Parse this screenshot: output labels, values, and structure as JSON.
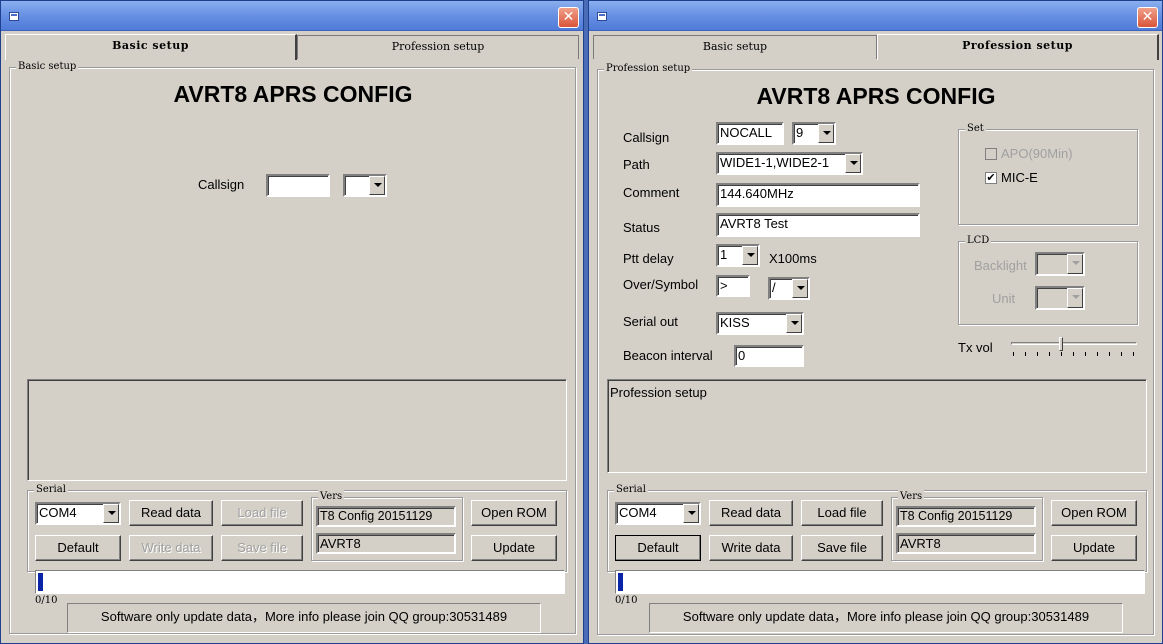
{
  "left": {
    "close_glyph": "✕",
    "tabs": [
      "Basic setup",
      "Profession setup"
    ],
    "group_label": "Basic setup",
    "title": "AVRT8 APRS CONFIG",
    "callsign_label": "Callsign",
    "callsign_value": "",
    "ssid_value": "",
    "serial": {
      "label": "Serial",
      "port": "COM4",
      "read": "Read data",
      "load": "Load file",
      "default": "Default",
      "write": "Write data",
      "save": "Save file",
      "vers_label": "Vers",
      "vers_value": "T8 Config 20151129",
      "model": "AVRT8",
      "open_rom": "Open ROM",
      "update": "Update"
    },
    "progress_label": "0/10",
    "progress": 0.01,
    "status": "Software only update data，More info please join QQ group:30531489"
  },
  "right": {
    "close_glyph": "✕",
    "tabs": [
      "Basic setup",
      "Profession setup"
    ],
    "group_label": "Profession setup",
    "title": "AVRT8 APRS CONFIG",
    "callsign_label": "Callsign",
    "callsign_value": "NOCALL",
    "ssid_value": "9",
    "path_label": "Path",
    "path_value": "WIDE1-1,WIDE2-1",
    "comment_label": "Comment",
    "comment_value": "144.640MHz",
    "status_label": "Status",
    "status_value": "AVRT8 Test",
    "ptt_label": "Ptt delay",
    "ptt_value": "1",
    "ptt_unit": "X100ms",
    "symbol_label": "Over/Symbol",
    "overlay_value": ">",
    "symbol_value": "/",
    "serial_out_label": "Serial out",
    "serial_out_value": "KISS",
    "beacon_label": "Beacon interval",
    "beacon_value": "0",
    "set_group": "Set",
    "apo_label": "APO(90Min)",
    "mice_label": "MIC-E",
    "mice_checked": "✔",
    "lcd_group": "LCD",
    "backlight_label": "Backlight",
    "unit_label": "Unit",
    "txvol_label": "Tx vol",
    "txvol_level": 0.4,
    "info_text": "Profession setup",
    "serial": {
      "label": "Serial",
      "port": "COM4",
      "read": "Read data",
      "load": "Load file",
      "default": "Default",
      "write": "Write data",
      "save": "Save file",
      "vers_label": "Vers",
      "vers_value": "T8 Config 20151129",
      "model": "AVRT8",
      "open_rom": "Open ROM",
      "update": "Update"
    },
    "progress_label": "0/10",
    "progress": 0.01,
    "status": "Software only update data，More info please join QQ group:30531489"
  }
}
